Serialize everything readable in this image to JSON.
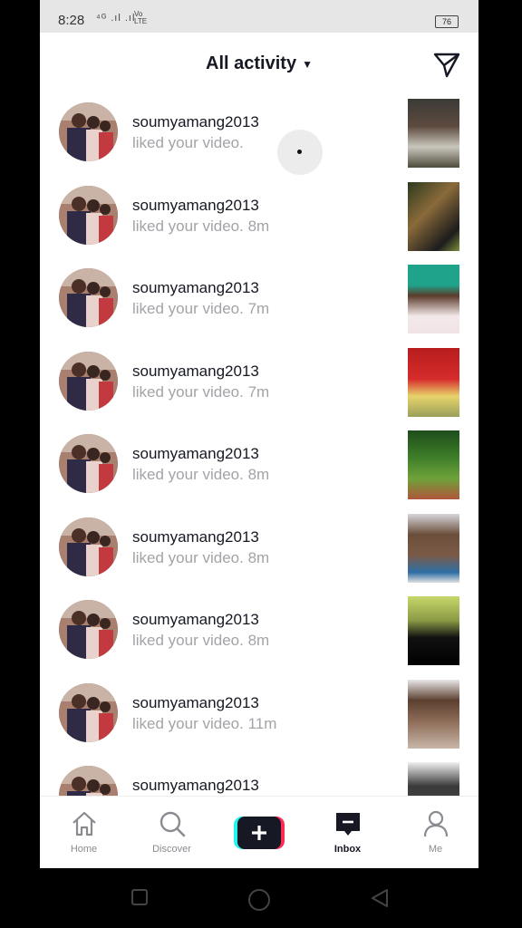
{
  "status_bar": {
    "time": "8:28",
    "signal": "⁴ᴳ .ıl .ıl",
    "network": "Vo LTE",
    "battery": "76"
  },
  "header": {
    "title": "All activity"
  },
  "activities": [
    {
      "user": "soumyamang2013",
      "text": "liked your video."
    },
    {
      "user": "soumyamang2013",
      "text": "liked your video. 8m"
    },
    {
      "user": "soumyamang2013",
      "text": "liked your video. 7m"
    },
    {
      "user": "soumyamang2013",
      "text": "liked your video. 7m"
    },
    {
      "user": "soumyamang2013",
      "text": "liked your video. 8m"
    },
    {
      "user": "soumyamang2013",
      "text": "liked your video. 8m"
    },
    {
      "user": "soumyamang2013",
      "text": "liked your video. 8m"
    },
    {
      "user": "soumyamang2013",
      "text": "liked your video. 11m"
    },
    {
      "user": "soumyamang2013",
      "text": ""
    }
  ],
  "tabbar": {
    "home": "Home",
    "discover": "Discover",
    "inbox": "Inbox",
    "me": "Me"
  },
  "colors": {
    "accent": "#fe2c55",
    "cyan": "#25f4ee",
    "text": "#161823",
    "muted": "#a3a3a8"
  }
}
